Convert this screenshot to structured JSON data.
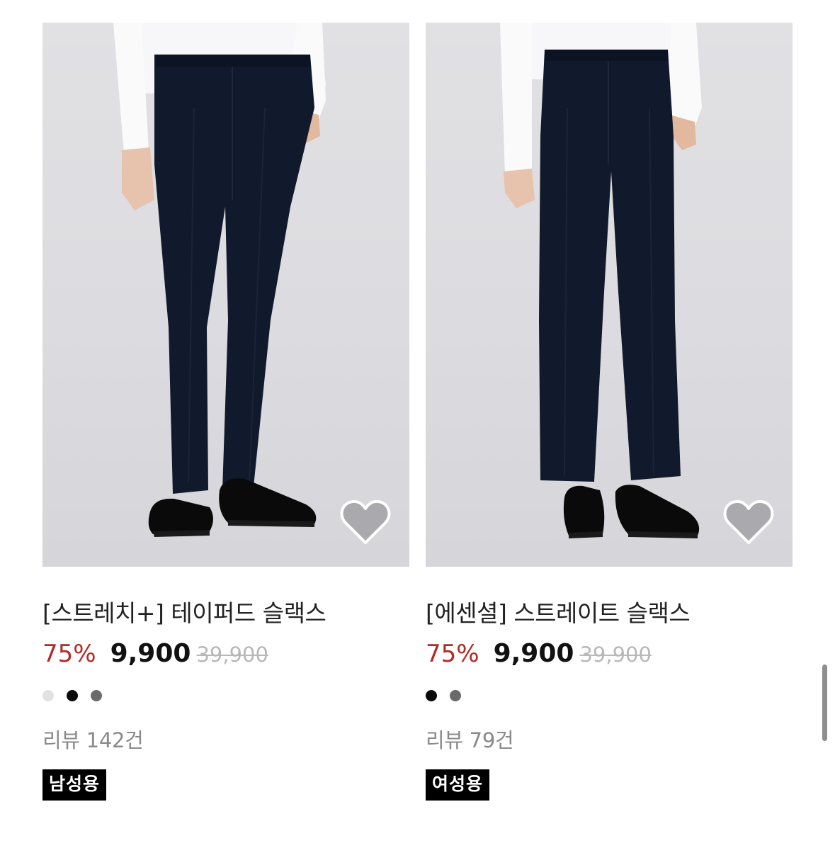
{
  "products": [
    {
      "title": "[스트레치+] 테이퍼드 슬랙스",
      "discount": "75%",
      "sale_price": "9,900",
      "original_price": "39,900",
      "swatches": [
        "#e2e2e2",
        "#0a0a0a",
        "#6a6a6a"
      ],
      "reviews": "리뷰 142건",
      "badge": "남성용",
      "wish_icon": "heart-icon"
    },
    {
      "title": "[에센셜] 스트레이트 슬랙스",
      "discount": "75%",
      "sale_price": "9,900",
      "original_price": "39,900",
      "swatches": [
        "#0a0a0a",
        "#6a6a6a"
      ],
      "reviews": "리뷰 79건",
      "badge": "여성용",
      "wish_icon": "heart-icon"
    }
  ],
  "colors": {
    "discount": "#b12a26",
    "original_price": "#b8b8b8",
    "badge_bg": "#000000"
  }
}
